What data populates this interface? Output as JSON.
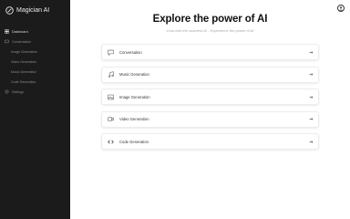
{
  "app": {
    "name": "Magician AI"
  },
  "sidebar": {
    "items": [
      {
        "label": "Dashboard",
        "icon": "grid-icon"
      },
      {
        "label": "Conversation",
        "icon": "chat-icon"
      },
      {
        "label": "Image Generation",
        "icon": "image-icon"
      },
      {
        "label": "Video Generation",
        "icon": "video-icon"
      },
      {
        "label": "Music Generation",
        "icon": "music-icon"
      },
      {
        "label": "Code Generation",
        "icon": "code-icon"
      },
      {
        "label": "Settings",
        "icon": "gear-icon"
      }
    ]
  },
  "main": {
    "title": "Explore the power of AI",
    "subtitle": "Chat with the smartest AI - Experience the power of AI",
    "cards": [
      {
        "label": "Conversation",
        "icon": "chat-icon"
      },
      {
        "label": "Music Generation",
        "icon": "music-icon"
      },
      {
        "label": "Image Generation",
        "icon": "image-icon"
      },
      {
        "label": "Video Generation",
        "icon": "video-icon"
      },
      {
        "label": "Code Generation",
        "icon": "code-icon"
      }
    ]
  },
  "colors": {
    "sidebar_bg": "#1b1b1b",
    "accent": "#111111"
  }
}
